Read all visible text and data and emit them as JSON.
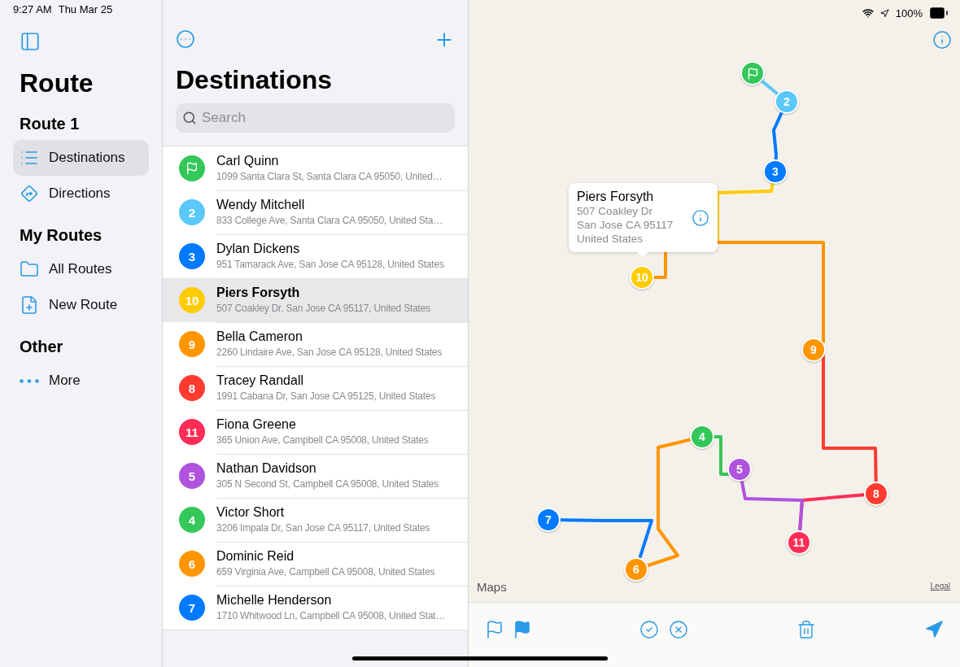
{
  "status_bar": {
    "time": "9:27 AM",
    "date": "Thu Mar 25",
    "battery": "100%"
  },
  "sidebar": {
    "title": "Route",
    "sections": [
      {
        "heading": "Route 1",
        "items": [
          {
            "label": "Destinations",
            "selected": true
          },
          {
            "label": "Directions",
            "selected": false
          }
        ]
      },
      {
        "heading": "My Routes",
        "items": [
          {
            "label": "All Routes",
            "selected": false
          },
          {
            "label": "New Route",
            "selected": false
          }
        ]
      },
      {
        "heading": "Other",
        "items": [
          {
            "label": "More",
            "selected": false
          }
        ]
      }
    ]
  },
  "list": {
    "title": "Destinations",
    "search": {
      "placeholder": "Search"
    },
    "rows": [
      {
        "name": "Carl Quinn",
        "address": "1099 Santa Clara St, Santa Clara CA 95050, United…",
        "kind": "flag",
        "color": "#34c759",
        "selected": false
      },
      {
        "name": "Wendy Mitchell",
        "address": "833 College Ave, Santa Clara CA 95050, United Sta…",
        "kind": "number",
        "number": "2",
        "color": "#5ac8fa",
        "selected": false
      },
      {
        "name": "Dylan Dickens",
        "address": "951 Tamarack Ave, San Jose CA 95128, United States",
        "kind": "number",
        "number": "3",
        "color": "#007aff",
        "selected": false
      },
      {
        "name": "Piers Forsyth",
        "address": "507 Coakley Dr, San Jose CA 95117, United States",
        "kind": "number",
        "number": "10",
        "color": "#ffcc00",
        "selected": true
      },
      {
        "name": "Bella Cameron",
        "address": "2260 Lindaire Ave, San Jose CA 95128, United States",
        "kind": "number",
        "number": "9",
        "color": "#ff9500",
        "selected": false
      },
      {
        "name": "Tracey Randall",
        "address": "1991 Cabana Dr, San Jose CA 95125, United States",
        "kind": "number",
        "number": "8",
        "color": "#ff3b30",
        "selected": false
      },
      {
        "name": "Fiona Greene",
        "address": "365 Union Ave, Campbell CA 95008, United States",
        "kind": "number",
        "number": "11",
        "color": "#ff2d55",
        "selected": false
      },
      {
        "name": "Nathan Davidson",
        "address": "305 N Second St, Campbell CA 95008, United States",
        "kind": "number",
        "number": "5",
        "color": "#af52de",
        "selected": false
      },
      {
        "name": "Victor Short",
        "address": "3206 Impala Dr, San Jose CA 95117, United States",
        "kind": "number",
        "number": "4",
        "color": "#34c759",
        "selected": false
      },
      {
        "name": "Dominic Reid",
        "address": "659 Virginia Ave, Campbell CA 95008, United States",
        "kind": "number",
        "number": "6",
        "color": "#ff9500",
        "selected": false
      },
      {
        "name": "Michelle Henderson",
        "address": "1710 Whitwood Ln, Campbell CA 95008, United Stat…",
        "kind": "number",
        "number": "7",
        "color": "#007aff",
        "selected": false
      }
    ]
  },
  "map": {
    "pins": [
      {
        "kind": "flag",
        "color": "#34c759"
      },
      {
        "kind": "number",
        "number": "2",
        "color": "#5ac8fa"
      },
      {
        "kind": "number",
        "number": "3",
        "color": "#007aff"
      },
      {
        "kind": "number",
        "number": "10",
        "color": "#ffcc00"
      },
      {
        "kind": "number",
        "number": "9",
        "color": "#ff9500"
      },
      {
        "kind": "number",
        "number": "8",
        "color": "#ff3b30"
      },
      {
        "kind": "number",
        "number": "11",
        "color": "#ff2d55"
      },
      {
        "kind": "number",
        "number": "5",
        "color": "#af52de"
      },
      {
        "kind": "number",
        "number": "4",
        "color": "#34c759"
      },
      {
        "kind": "number",
        "number": "6",
        "color": "#ff9500"
      },
      {
        "kind": "number",
        "number": "7",
        "color": "#007aff"
      }
    ],
    "callout": {
      "name": "Piers Forsyth",
      "lines": [
        "507 Coakley Dr",
        "San Jose CA 95117",
        "United States"
      ]
    },
    "logo": "Maps",
    "legal": "Legal"
  }
}
